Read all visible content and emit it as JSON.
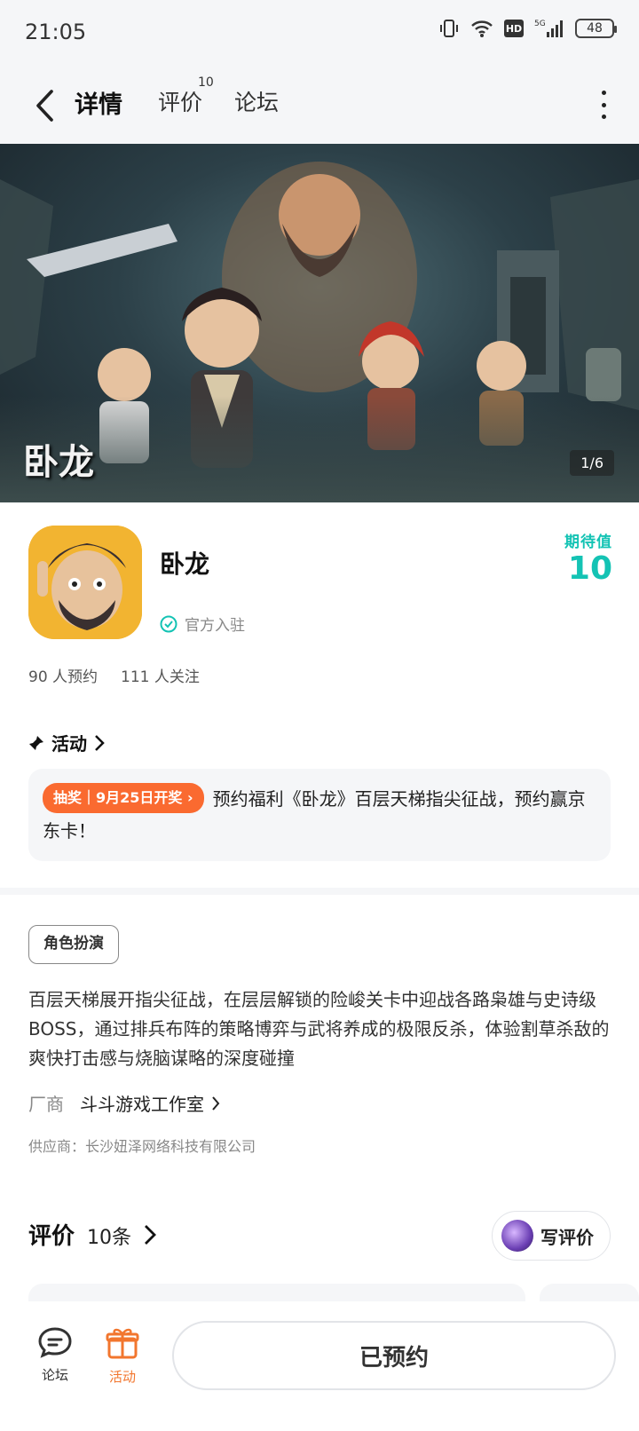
{
  "status_bar": {
    "time": "21:05",
    "network": "5G",
    "battery": "48",
    "hd": "HD"
  },
  "nav": {
    "tabs": [
      {
        "label": "详情"
      },
      {
        "label": "评价",
        "count": "10"
      },
      {
        "label": "论坛"
      }
    ]
  },
  "banner": {
    "logo_text": "卧龙",
    "page_indicator": "1/6"
  },
  "game": {
    "name": "卧龙",
    "official_label": "官方入驻",
    "expectation_label": "期待值",
    "expectation_value": "10",
    "reservations": "90 人预约",
    "followers": "111 人关注"
  },
  "activity": {
    "title": "活动",
    "tag": "抽奖｜9月25日开奖",
    "text": "预约福利《卧龙》百层天梯指尖征战，预约赢京东卡！"
  },
  "details": {
    "genre": "角色扮演",
    "description": "百层天梯展开指尖征战，在层层解锁的险峻关卡中迎战各路枭雄与史诗级BOSS，通过排兵布阵的策略博弈与武将养成的极限反杀，体验割草杀敌的爽快打击感与烧脑谋略的深度碰撞",
    "vendor_label": "厂商",
    "vendor_name": "斗斗游戏工作室",
    "supplier": "供应商：长沙妞泽网络科技有限公司"
  },
  "reviews": {
    "title": "评价",
    "count": "10条",
    "write_label": "写评价"
  },
  "bottom_bar": {
    "forum_label": "论坛",
    "activity_label": "活动",
    "reserved_label": "已预约"
  },
  "colors": {
    "accent": "#14c3b4",
    "tab_underline": "#1cd0c0",
    "lottery": "#fa6a30",
    "active_tab": "#f2762e"
  },
  "icons": [
    "back-icon",
    "more-icon",
    "check-circle-icon",
    "pin-icon",
    "chevron-right-icon",
    "forum-icon",
    "gift-icon"
  ]
}
